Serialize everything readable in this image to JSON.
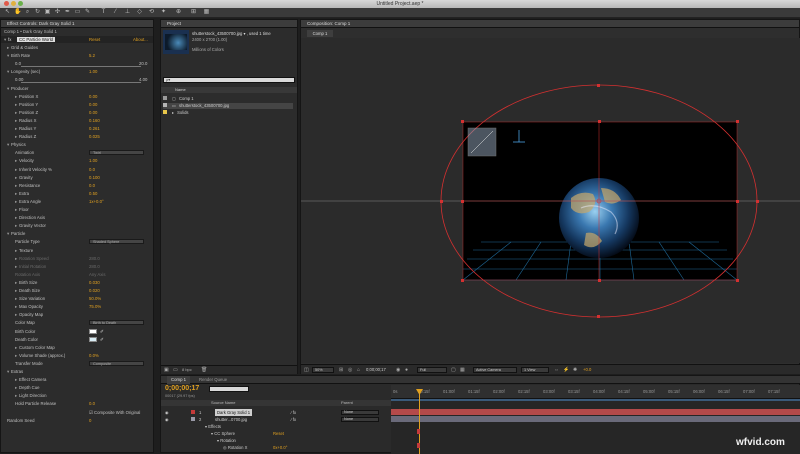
{
  "app": {
    "window_title": "Untitled Project.aep *"
  },
  "effect_controls": {
    "tab_title": "Effect Controls: Dark Gray Solid 1",
    "breadcrumb": "Comp 1 • Dark Gray Solid 1",
    "effect_name": "CC Particle World",
    "reset": "Reset",
    "about": "About...",
    "rows": [
      {
        "label": "Grid & Guides",
        "indent": 1,
        "tri": "▸",
        "value": ""
      },
      {
        "label": "Birth Rate",
        "indent": 1,
        "tri": "▾",
        "value": "5.2"
      },
      {
        "label": "0.0",
        "indent": 2,
        "tri": "",
        "value": "",
        "right": "20.0",
        "slider": true
      },
      {
        "label": "Longevity (sec)",
        "indent": 1,
        "tri": "▾",
        "value": "1.00"
      },
      {
        "label": "0.00",
        "indent": 2,
        "tri": "",
        "value": "",
        "right": "4.00",
        "slider": true
      },
      {
        "label": "Producer",
        "indent": 1,
        "tri": "▾",
        "value": ""
      },
      {
        "label": "Position X",
        "indent": 2,
        "tri": "▸",
        "value": "0.00"
      },
      {
        "label": "Position Y",
        "indent": 2,
        "tri": "▸",
        "value": "0.00"
      },
      {
        "label": "Position Z",
        "indent": 2,
        "tri": "▸",
        "value": "0.00"
      },
      {
        "label": "Radius X",
        "indent": 2,
        "tri": "▸",
        "value": "0.160"
      },
      {
        "label": "Radius Y",
        "indent": 2,
        "tri": "▸",
        "value": "0.261"
      },
      {
        "label": "Radius Z",
        "indent": 2,
        "tri": "▸",
        "value": "0.025"
      },
      {
        "label": "Physics",
        "indent": 1,
        "tri": "▾",
        "value": ""
      },
      {
        "label": "Animation",
        "indent": 2,
        "tri": "",
        "value": "",
        "dropdown": "Twirl"
      },
      {
        "label": "Velocity",
        "indent": 2,
        "tri": "▸",
        "value": "1.00"
      },
      {
        "label": "Inherit Velocity %",
        "indent": 2,
        "tri": "▸",
        "value": "0.0"
      },
      {
        "label": "Gravity",
        "indent": 2,
        "tri": "▸",
        "value": "0.100"
      },
      {
        "label": "Resistance",
        "indent": 2,
        "tri": "▸",
        "value": "0.0"
      },
      {
        "label": "Extra",
        "indent": 2,
        "tri": "▸",
        "value": "0.50"
      },
      {
        "label": "Extra Angle",
        "indent": 2,
        "tri": "▸",
        "value": "1x+0.0°"
      },
      {
        "label": "Floor",
        "indent": 2,
        "tri": "▸",
        "value": ""
      },
      {
        "label": "Direction Axis",
        "indent": 2,
        "tri": "▸",
        "value": ""
      },
      {
        "label": "Gravity Vector",
        "indent": 2,
        "tri": "▸",
        "value": ""
      },
      {
        "label": "Particle",
        "indent": 1,
        "tri": "▾",
        "value": ""
      },
      {
        "label": "Particle Type",
        "indent": 2,
        "tri": "",
        "value": "",
        "dropdown": "Shaded Sphere"
      },
      {
        "label": "Texture",
        "indent": 2,
        "tri": "▸",
        "value": ""
      },
      {
        "label": "Rotation Speed",
        "indent": 2,
        "tri": "▸",
        "value": "",
        "disabled": true,
        "dvalue": "280.0"
      },
      {
        "label": "Initial Rotation",
        "indent": 2,
        "tri": "▸",
        "value": "",
        "disabled": true,
        "dvalue": "280.0"
      },
      {
        "label": "Rotation Axis",
        "indent": 2,
        "tri": "",
        "value": "",
        "disabled": true,
        "dvalue": "Any Axis"
      },
      {
        "label": "Birth Size",
        "indent": 2,
        "tri": "▸",
        "value": "0.030"
      },
      {
        "label": "Death Size",
        "indent": 2,
        "tri": "▸",
        "value": "0.020"
      },
      {
        "label": "Size Variation",
        "indent": 2,
        "tri": "▸",
        "value": "50.0%"
      },
      {
        "label": "Max Opacity",
        "indent": 2,
        "tri": "▸",
        "value": "75.0%"
      },
      {
        "label": "Opacity Map",
        "indent": 2,
        "tri": "▸",
        "value": ""
      },
      {
        "label": "Color Map",
        "indent": 2,
        "tri": "",
        "value": "",
        "dropdown": "Birth to Death"
      },
      {
        "label": "Birth Color",
        "indent": 2,
        "tri": "",
        "value": "",
        "swatch": "#ffffff"
      },
      {
        "label": "Death Color",
        "indent": 2,
        "tri": "",
        "value": "",
        "swatch": "#d8ecf4"
      },
      {
        "label": "Custom Color Map",
        "indent": 2,
        "tri": "▸",
        "value": ""
      },
      {
        "label": "Volume Shade (approx.)",
        "indent": 2,
        "tri": "▸",
        "value": "0.0%"
      },
      {
        "label": "Transfer Mode",
        "indent": 2,
        "tri": "",
        "value": "",
        "dropdown": "Composite"
      },
      {
        "label": "Extras",
        "indent": 1,
        "tri": "▾",
        "value": ""
      },
      {
        "label": "Effect Camera",
        "indent": 2,
        "tri": "▸",
        "value": ""
      },
      {
        "label": "Depth Cue",
        "indent": 2,
        "tri": "▸",
        "value": ""
      },
      {
        "label": "Light Direction",
        "indent": 2,
        "tri": "▸",
        "value": ""
      },
      {
        "label": "Hold Particle Release",
        "indent": 2,
        "tri": "",
        "value": "0.0"
      },
      {
        "label": "",
        "indent": 2,
        "tri": "",
        "value": "",
        "checkbox": "Composite With Original"
      },
      {
        "label": "Random Seed",
        "indent": 1,
        "tri": "",
        "value": "0"
      }
    ]
  },
  "project": {
    "tab_title": "Project",
    "file_name": "shutterstock_43500700.jpg ▾ , used 1 time",
    "file_dims": "2400 x 2700 (1.00)",
    "file_colors": "Millions of Colors",
    "search_placeholder": "ρ▾",
    "col_name": "Name",
    "items": [
      {
        "icon": "▢",
        "name": "Comp 1",
        "color": "#9a9a9a"
      },
      {
        "icon": "▭",
        "name": "shutterstock_43500700.jpg",
        "color": "#b4b4b4"
      },
      {
        "icon": "▸",
        "name": "Solids",
        "color": "#e8c64a"
      }
    ],
    "bpc": "8 bpc"
  },
  "composition": {
    "tab_title": "Composition: Comp 1",
    "comp_tab": "Comp 1",
    "footer": {
      "zoom": "50%",
      "time": "0;00;00;17",
      "quality": "Full",
      "camera": "Active Camera",
      "view": "1 View",
      "offset": "+0.0"
    }
  },
  "timeline": {
    "tab_comp": "Comp 1",
    "tab_render": "Render Queue",
    "timecode": "0;00;00;17",
    "timecode_sub": "00017 (29.97 fps)",
    "col_source": "Source Name",
    "col_parent": "Parent",
    "layers": [
      {
        "num": "1",
        "name": "Dark Gray Solid 1",
        "parent": "None",
        "color": "#c43a3a"
      },
      {
        "num": "2",
        "name": "shutter...0700.jpg",
        "parent": "None",
        "color": "#9a9aa8"
      }
    ],
    "sub": [
      {
        "label": "Effects",
        "value": ""
      },
      {
        "label": "CC Sphere",
        "value": "Reset"
      },
      {
        "label": "Rotation",
        "value": ""
      },
      {
        "label": "Rotation X",
        "value": "0x+0.0°"
      }
    ],
    "ruler": [
      "0s",
      "00:15f",
      "01:00f",
      "01:15f",
      "02:00f",
      "02:15f",
      "03:00f",
      "03:15f",
      "04:00f",
      "04:15f",
      "05:00f",
      "05:15f",
      "06:00f",
      "06:15f",
      "07:00f",
      "07:15f"
    ]
  },
  "watermark": "wfvid.com"
}
